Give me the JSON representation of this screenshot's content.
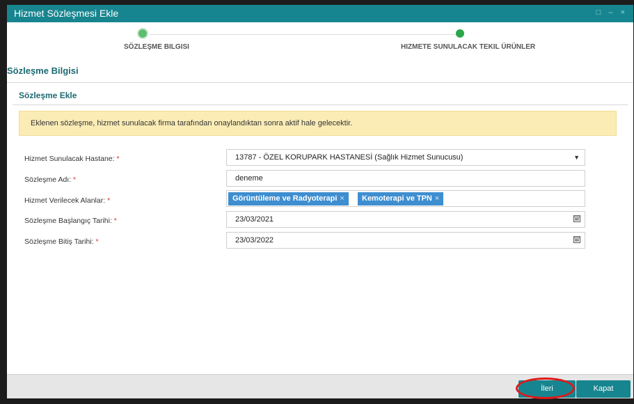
{
  "window": {
    "title": "Hizmet Sözleşmesi Ekle",
    "controls": [
      "□",
      "–",
      "×"
    ]
  },
  "wizard": {
    "steps": [
      {
        "label": "SÖZLEŞME BILGISI"
      },
      {
        "label": "HIZMETE SUNULACAK TEKIL ÜRÜNLER"
      }
    ]
  },
  "section_title": "Sözleşme Bilgisi",
  "panel_title": "Sözleşme Ekle",
  "alert": "Eklenen sözleşme, hizmet sunulacak firma tarafından onaylandıktan sonra aktif hale gelecektir.",
  "form": {
    "required_mark": "*",
    "hospital": {
      "label": "Hizmet Sunulacak Hastane:",
      "value": "13787 - ÖZEL KORUPARK HASTANESİ (Sağlık Hizmet Sunucusu)",
      "caret": "▼"
    },
    "name": {
      "label": "Sözleşme Adı:",
      "value": "deneme"
    },
    "areas": {
      "label": "Hizmet Verilecek Alanlar:",
      "tags": [
        "Görüntüleme ve Radyoterapi",
        "Kemoterapi ve TPN"
      ],
      "remove": "×"
    },
    "start": {
      "label": "Sözleşme Başlangıç Tarihi:",
      "value": "23/03/2021"
    },
    "end": {
      "label": "Sözleşme Bitiş Tarihi:",
      "value": "23/03/2022"
    }
  },
  "footer": {
    "next": "İleri",
    "close": "Kapat"
  },
  "colors": {
    "accent": "#17858f",
    "alert_bg": "#fbecb6",
    "tag_bg": "#3e8ed0",
    "required": "#e03030",
    "highlight": "#e01818"
  }
}
